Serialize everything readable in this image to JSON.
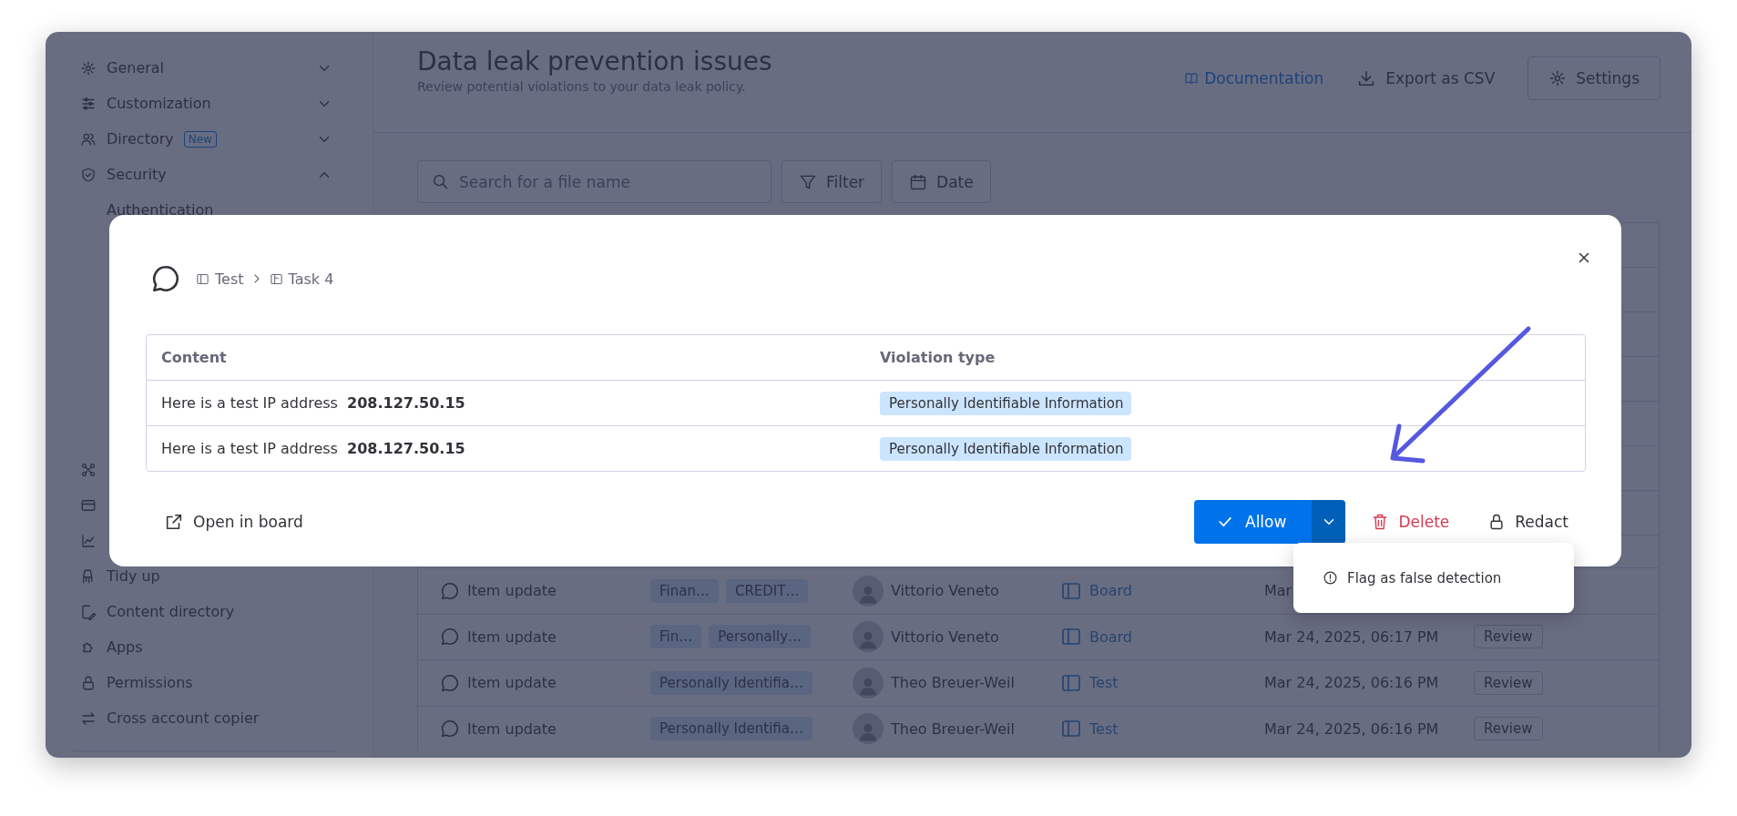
{
  "sidebar": {
    "items": [
      {
        "kind": "section",
        "label": "General",
        "expanded": false
      },
      {
        "kind": "section",
        "label": "Customization",
        "expanded": false
      },
      {
        "kind": "section",
        "label": "Directory",
        "badge": "New",
        "expanded": false
      },
      {
        "kind": "section",
        "label": "Security",
        "expanded": true,
        "children": [
          {
            "label": "Authentication",
            "selected": false
          }
        ]
      },
      {
        "kind": "link"
      },
      {
        "kind": "link"
      },
      {
        "kind": "link"
      },
      {
        "kind": "link",
        "label": "Tidy up"
      },
      {
        "kind": "link",
        "label": "Content directory"
      },
      {
        "kind": "link",
        "label": "Apps"
      },
      {
        "kind": "link",
        "label": "Permissions"
      },
      {
        "kind": "link",
        "label": "Cross account copier"
      }
    ]
  },
  "header": {
    "title": "Data leak prevention issues",
    "subtitle": "Review potential violations to your data leak policy.",
    "documentation_link": "Documentation",
    "export_button": "Export as CSV",
    "settings_button": "Settings"
  },
  "toolbar": {
    "search": {
      "placeholder": "Search for a file name"
    },
    "filter_button": "Filter",
    "date_button": "Date"
  },
  "table": {
    "rows": [
      {
        "type": "Item update",
        "tags": [
          "Finan…",
          "CREDIT…"
        ],
        "user": "Vittorio Veneto",
        "location": "Board",
        "date": "Mar"
      },
      {
        "type": "Item update",
        "tags": [
          "Fin…",
          "Personally…"
        ],
        "user": "Vittorio Veneto",
        "location": "Board",
        "date": "Mar 24, 2025, 06:17 PM",
        "action": "Review"
      },
      {
        "type": "Item update",
        "tags": [
          "Personally Identifia…"
        ],
        "user": "Theo Breuer-Weil",
        "location": "Test",
        "date": "Mar 24, 2025, 06:16 PM",
        "action": "Review"
      },
      {
        "type": "Item update",
        "tags": [
          "Personally Identifia…"
        ],
        "user": "Theo Breuer-Weil",
        "location": "Test",
        "date": "Mar 24, 2025, 06:16 PM",
        "action": "Review"
      }
    ]
  },
  "modal": {
    "breadcrumb": [
      "Test",
      "Task 4"
    ],
    "table": {
      "columns": [
        "Content",
        "Violation type"
      ],
      "rows": [
        {
          "content": "Here is a test IP address  **208.127.50.15**",
          "violation": "Personally Identifiable Information"
        },
        {
          "content": "Here is a test IP address  **208.127.50.15**",
          "violation": "Personally Identifiable Information"
        }
      ]
    },
    "open_in_board": "Open in board",
    "allow_button": "Allow",
    "delete_button": "Delete",
    "redact_button": "Redact"
  },
  "menu": {
    "items": [
      "Flag as false detection"
    ]
  }
}
